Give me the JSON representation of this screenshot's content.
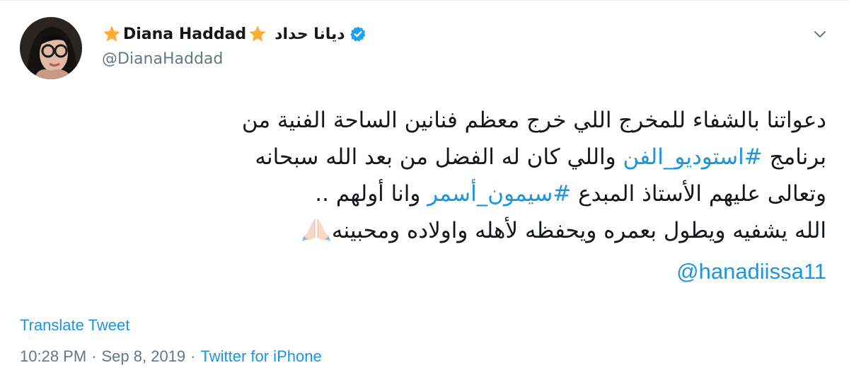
{
  "author": {
    "display_name": "Diana Haddad",
    "arabic_name": "ديانا حداد",
    "handle": "@DianaHaddad",
    "verified": true,
    "name_decoration": "star-icon"
  },
  "tweet": {
    "lines": [
      {
        "parts": [
          {
            "text": "دعواتنا بالشفاء للمخرج اللي خرج معظم فنانين الساحة الفنية من",
            "type": "text"
          }
        ]
      },
      {
        "parts": [
          {
            "text": "برنامج ",
            "type": "text"
          },
          {
            "text": "#استوديو_الفن",
            "type": "hashtag"
          },
          {
            "text": " واللي كان له الفضل من بعد الله سبحانه",
            "type": "text"
          }
        ]
      },
      {
        "parts": [
          {
            "text": "وتعالى عليهم الأستاذ المبدع ",
            "type": "text"
          },
          {
            "text": "#سيمون_أسمر",
            "type": "hashtag"
          },
          {
            "text": " وانا أولهم ..",
            "type": "text"
          }
        ]
      },
      {
        "parts": [
          {
            "text": "الله يشفيه ويطول بعمره ويحفظه لأهله واولاده ومحبينه",
            "type": "text"
          }
        ],
        "emoji": "folded-hands-emoji"
      }
    ],
    "mention": "@hanadiissa11"
  },
  "translate_label": "Translate Tweet",
  "meta": {
    "time": "10:28 PM",
    "separator": "·",
    "date": "Sep 8, 2019",
    "source": "Twitter for iPhone"
  },
  "colors": {
    "link": "#1b95e0",
    "text": "#14171a",
    "secondary": "#657786",
    "star": "#ffac33",
    "verified": "#1da1f2"
  }
}
